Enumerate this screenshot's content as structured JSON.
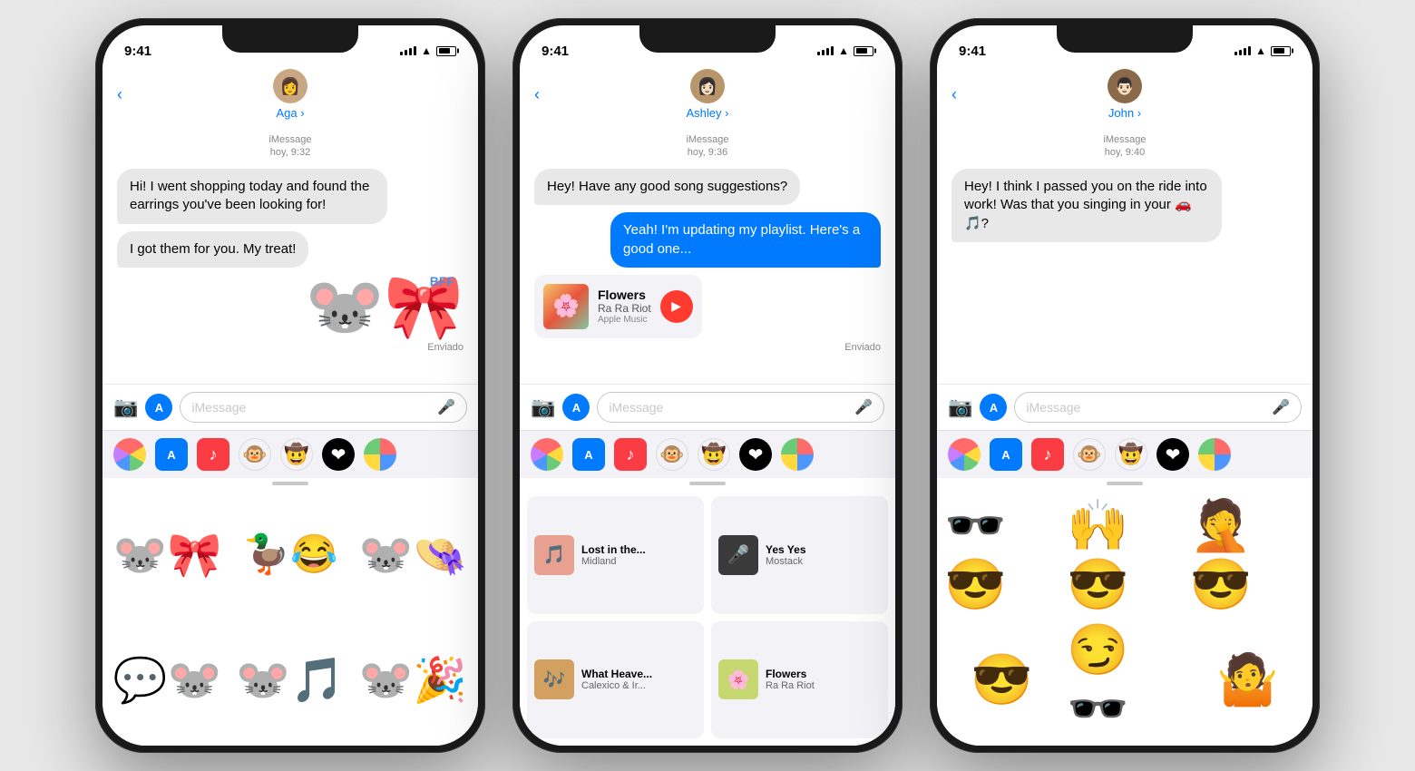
{
  "phones": [
    {
      "id": "phone-aga",
      "time": "9:41",
      "contact": "Aga",
      "has_chevron": true,
      "avatar_emoji": "👩",
      "avatar_color": "#c8a882",
      "messages": [
        {
          "type": "label",
          "text": "iMessage"
        },
        {
          "type": "time",
          "text": "hoy, 9:32"
        },
        {
          "type": "received",
          "text": "Hi! I went shopping today and found the earrings you've been looking for!"
        },
        {
          "type": "received",
          "text": "I got them for you. My treat!"
        },
        {
          "type": "sticker",
          "emoji": "🐭🎀"
        },
        {
          "type": "enviado"
        }
      ],
      "input_placeholder": "iMessage",
      "app_icons": [
        "📷",
        "A",
        "🎵",
        "🐵",
        "🤠",
        "❤",
        "🌈"
      ],
      "bottom_type": "stickers",
      "stickers": [
        "🐭🎀",
        "🦆😂",
        "🐭👒",
        "💬",
        "🐭🎵",
        "🐭🎉"
      ]
    },
    {
      "id": "phone-ashley",
      "time": "9:41",
      "contact": "Ashley",
      "has_chevron": true,
      "avatar_emoji": "👩🏻",
      "avatar_color": "#b8956a",
      "messages": [
        {
          "type": "label",
          "text": "iMessage"
        },
        {
          "type": "time",
          "text": "hoy, 9:36"
        },
        {
          "type": "received",
          "text": "Hey! Have any good song suggestions?"
        },
        {
          "type": "sent",
          "text": "Yeah! I'm updating my playlist. Here's a good one..."
        },
        {
          "type": "music_card",
          "title": "Flowers",
          "artist": "Ra Ra Riot",
          "source": "Apple Music"
        },
        {
          "type": "enviado"
        }
      ],
      "input_placeholder": "iMessage",
      "app_icons": [
        "📷",
        "A",
        "🎵",
        "🐵",
        "🤠",
        "❤",
        "🌈"
      ],
      "bottom_type": "music",
      "music_items": [
        {
          "title": "Lost in the...",
          "artist": "Midland",
          "color": "#e8a090"
        },
        {
          "title": "Yes Yes",
          "artist": "Mostack",
          "color": "#3a3a3a"
        },
        {
          "title": "What Heave...",
          "artist": "Calexico & Ir...",
          "color": "#d4a060"
        },
        {
          "title": "Flowers",
          "artist": "Ra Ra Riot",
          "color": "#c8d870"
        }
      ]
    },
    {
      "id": "phone-john",
      "time": "9:41",
      "contact": "John",
      "has_chevron": true,
      "avatar_emoji": "👨🏻",
      "avatar_color": "#8a6a4a",
      "messages": [
        {
          "type": "label",
          "text": "iMessage"
        },
        {
          "type": "time",
          "text": "hoy, 9:40"
        },
        {
          "type": "received",
          "text": "Hey! I think I passed you on the ride into work! Was that you singing in your 🚗🎵?"
        }
      ],
      "input_placeholder": "iMessage",
      "app_icons": [
        "📷",
        "A",
        "🎵",
        "🐵",
        "🤠",
        "❤",
        "🌈"
      ],
      "bottom_type": "memoji",
      "memoji_items": [
        "🕶😎",
        "🙌😎",
        "🤦😎",
        "😎",
        "🕶😏",
        "🤷"
      ]
    }
  ],
  "labels": {
    "enviado": "Enviado",
    "apple_music": "Apple Music",
    "imessage": "iMessage",
    "back_arrow": "‹"
  }
}
